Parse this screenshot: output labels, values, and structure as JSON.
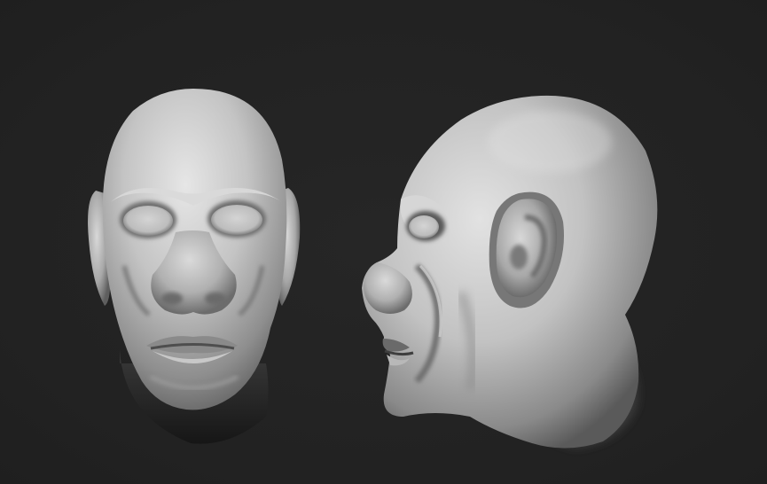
{
  "scene": {
    "background_color": "#232323",
    "material_color": "#bdbdbd",
    "views": [
      {
        "name": "front-view"
      },
      {
        "name": "side-view"
      }
    ]
  }
}
